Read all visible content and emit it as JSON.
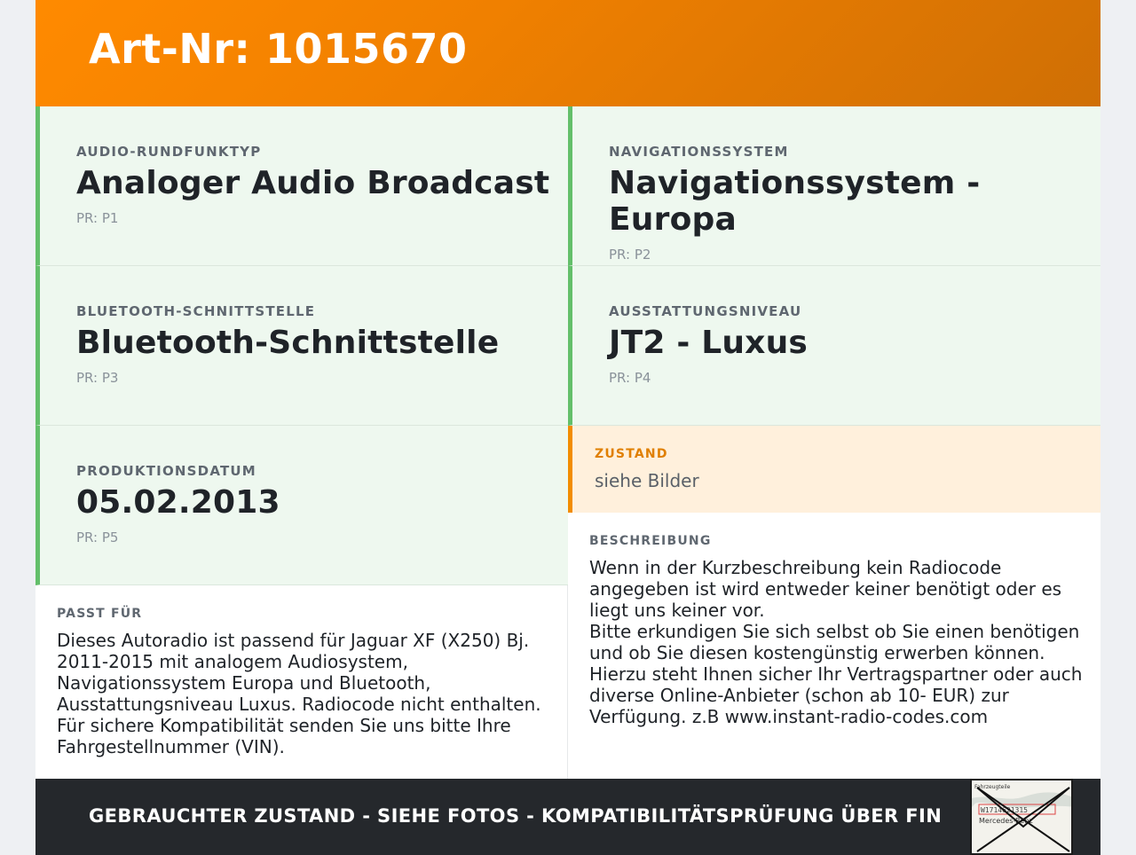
{
  "header": {
    "title": "Art-Nr: 1015670"
  },
  "specs": [
    {
      "label": "AUDIO-RUNDFUNKTYP",
      "value": "Analoger Audio Broadcast",
      "pr": "PR: P1"
    },
    {
      "label": "NAVIGATIONSSYSTEM",
      "value": "Navigationssystem - Europa",
      "pr": "PR: P2"
    },
    {
      "label": "BLUETOOTH-SCHNITTSTELLE",
      "value": "Bluetooth-Schnittstelle",
      "pr": "PR: P3"
    },
    {
      "label": "AUSSTATTUNGSNIVEAU",
      "value": "JT2 - Luxus",
      "pr": "PR: P4"
    },
    {
      "label": "PRODUKTIONSDATUM",
      "value": "05.02.2013",
      "pr": "PR: P5"
    }
  ],
  "zustand": {
    "label": "ZUSTAND",
    "value": "siehe Bilder"
  },
  "passt": {
    "label": "PASST FÜR",
    "text": "Dieses Autoradio ist passend für Jaguar XF (X250) Bj. 2011-2015 mit analogem Audiosystem, Navigationssystem Europa und Bluetooth, Ausstattungsniveau Luxus. Radiocode nicht enthalten. Für sichere Kompatibilität senden Sie uns bitte Ihre Fahrgestellnummer (VIN)."
  },
  "beschreibung": {
    "label": "BESCHREIBUNG",
    "text": "Wenn in der Kurzbeschreibung kein Radiocode angegeben ist wird entweder keiner benötigt oder es liegt uns keiner vor.\nBitte erkundigen Sie sich selbst ob Sie einen benötigen und ob Sie diesen kostengünstig erwerben können. Hierzu steht Ihnen sicher Ihr Vertragspartner oder auch diverse Online-Anbieter (schon ab 10- EUR) zur Verfügung. z.B www.instant-radio-codes.com"
  },
  "footer": {
    "note": "GEBRAUCHTER ZUSTAND - SIEHE FOTOS - KOMPATIBILITÄTSPRÜFUNG ÜBER FIN",
    "thumb_texts": [
      "Fahrzeugteile",
      "W1714621315",
      "Mercedes-Benz"
    ]
  },
  "colors": {
    "header_orange": "#f08000",
    "accent_green": "#63bf6a",
    "cell_bg": "#eef8ef",
    "zustand_bg": "#fff0dc",
    "zustand_accent": "#f28c00",
    "footer_bg": "#25282c"
  }
}
